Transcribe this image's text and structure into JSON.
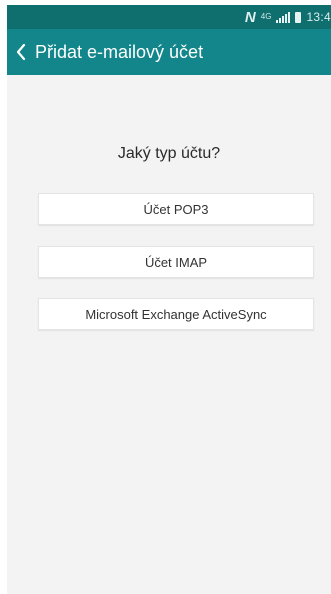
{
  "status_bar": {
    "time": "13:4",
    "nfc_icon": "N",
    "network_icon": "4G",
    "background": "#0f6f6f"
  },
  "action_bar": {
    "title": "Přidat e-mailový účet",
    "background": "#12868a"
  },
  "content": {
    "question": "Jaký typ účtu?",
    "options": [
      {
        "label": "Účet POP3"
      },
      {
        "label": "Účet IMAP"
      },
      {
        "label": "Microsoft Exchange ActiveSync"
      }
    ]
  }
}
